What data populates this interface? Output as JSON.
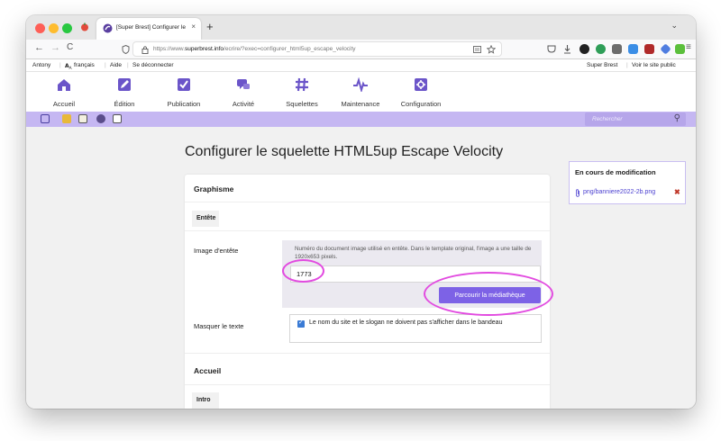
{
  "browser": {
    "tab_title": "[Super Brest] Configurer le squelette",
    "tab_close": "×",
    "new_tab": "+",
    "back": "←",
    "forward": "→",
    "reload": "C",
    "url_prefix": "https://www.",
    "url_domain": "superbrest.info",
    "url_rest": "/ecrire/?exec=configurer_html5up_escape_velocity",
    "menu_glyph": "≡",
    "tab_list_glyph": "⌄"
  },
  "spip_top": {
    "user": "Antony",
    "language": "français",
    "help": "Aide",
    "logout": "Se déconnecter",
    "site_name": "Super Brest",
    "view_site": "Voir le site public"
  },
  "main_menu": [
    {
      "label": "Accueil",
      "icon": "home-icon"
    },
    {
      "label": "Édition",
      "icon": "pencil-icon"
    },
    {
      "label": "Publication",
      "icon": "checkbox-icon"
    },
    {
      "label": "Activité",
      "icon": "chat-icon"
    },
    {
      "label": "Squelettes",
      "icon": "hash-icon"
    },
    {
      "label": "Maintenance",
      "icon": "pulse-icon"
    },
    {
      "label": "Configuration",
      "icon": "gear-icon"
    }
  ],
  "search": {
    "placeholder": "Rechercher",
    "glyph": "⚲"
  },
  "page": {
    "title": "Configurer le squelette HTML5up Escape Velocity"
  },
  "form": {
    "section1": "Graphisme",
    "sub1": "Entête",
    "image_label": "Image d'entête",
    "image_explanation": "Numéro du document image utilisé en entête. Dans le template original, l'image a une taille de 1920x653 pixels.",
    "image_value": "1773",
    "browse_button": "Parcourir la médiathèque",
    "hide_text_label": "Masquer le texte",
    "hide_text_option": "Le nom du site et le slogan ne doivent pas s'afficher dans le bandeau",
    "section2": "Accueil",
    "sub2": "Intro"
  },
  "sidebar": {
    "title": "En cours de modification",
    "file": "png/banniere2022-2b.png",
    "remove_glyph": "✖"
  },
  "colors": {
    "accent": "#7d62e6",
    "purple_bar": "#c5b7f2",
    "highlight": "#e24be0"
  }
}
